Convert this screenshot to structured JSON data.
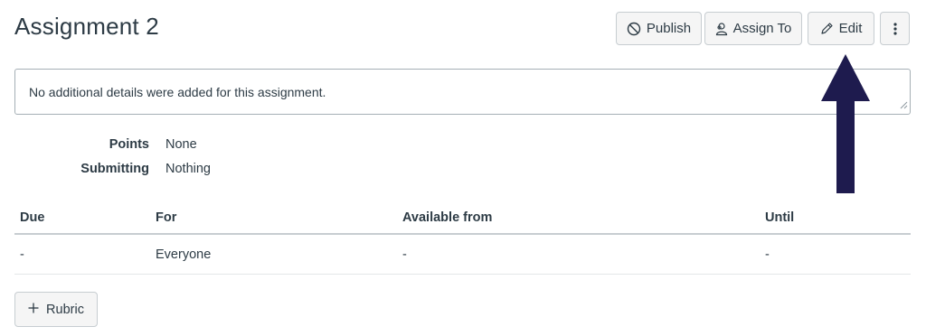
{
  "header": {
    "title": "Assignment 2",
    "publish_label": "Publish",
    "assign_label": "Assign To",
    "edit_label": "Edit"
  },
  "details": {
    "text": "No additional details were added for this assignment."
  },
  "meta": {
    "points_label": "Points",
    "points_value": "None",
    "submitting_label": "Submitting",
    "submitting_value": "Nothing"
  },
  "table": {
    "headers": [
      "Due",
      "For",
      "Available from",
      "Until"
    ],
    "rows": [
      [
        "-",
        "Everyone",
        "-",
        "-"
      ]
    ]
  },
  "rubric": {
    "label": "Rubric"
  },
  "colors": {
    "arrow": "#1e1b4e",
    "button_bg": "#f5f5f5",
    "text": "#2d3b45"
  },
  "icons": {
    "publish": "no-entry-icon",
    "assign": "user-group-icon",
    "edit": "pencil-icon",
    "more": "vertical-ellipsis-icon",
    "rubric": "plus-icon"
  }
}
